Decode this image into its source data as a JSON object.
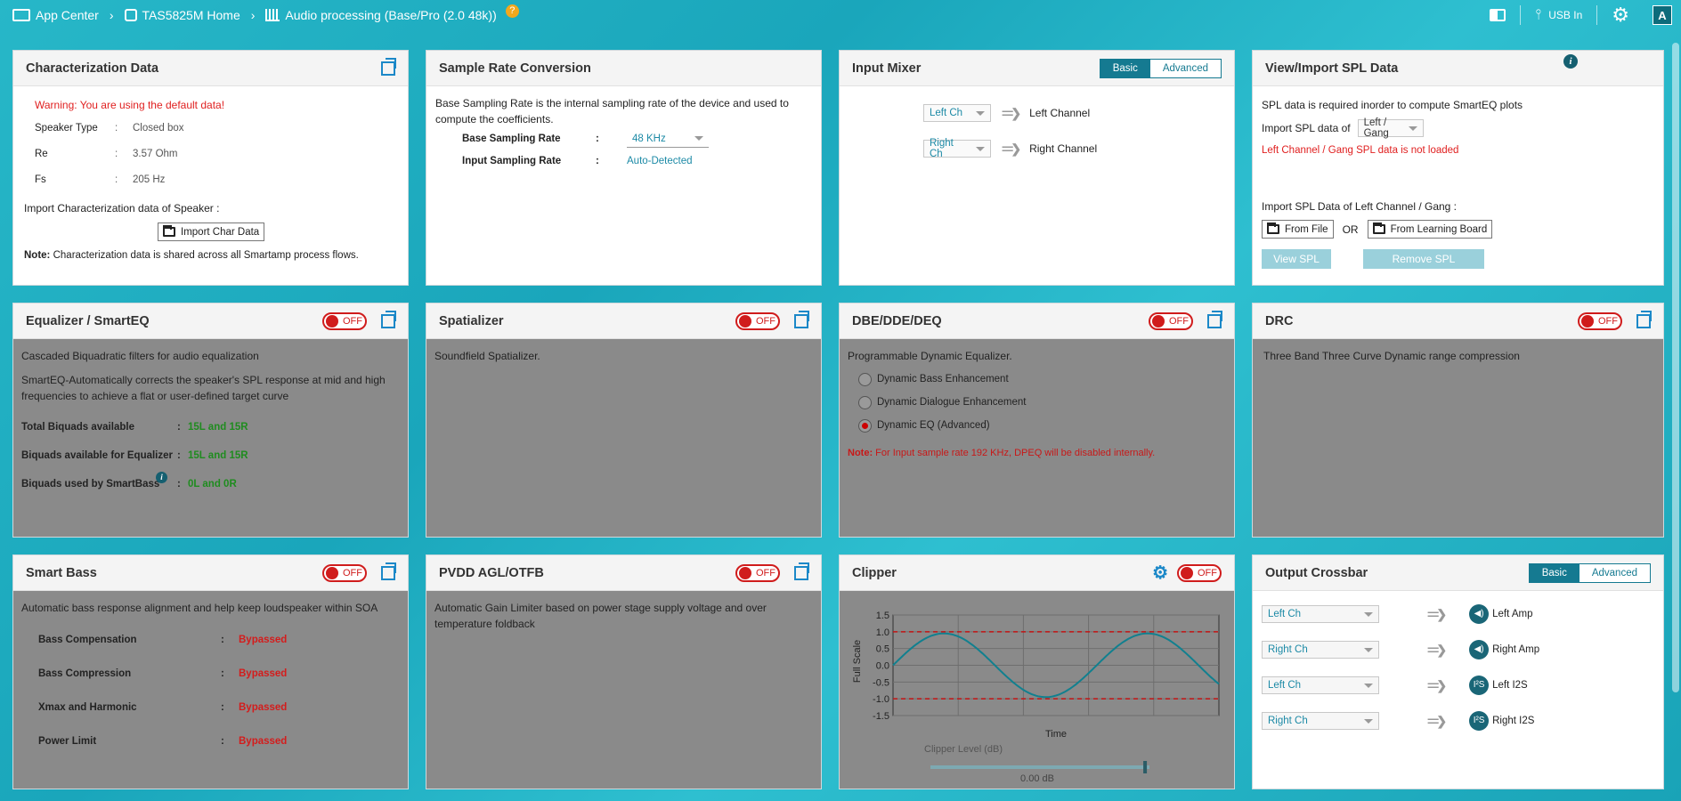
{
  "breadcrumb": {
    "app_center": "App Center",
    "device": "TAS5825M Home",
    "flow": "Audio processing (Base/Pro (2.0 48k))",
    "help": "?"
  },
  "topright": {
    "usb_label": "USB In",
    "avatar": "A"
  },
  "characterization": {
    "title": "Characterization Data",
    "warning": "Warning: You are using the default data!",
    "rows": [
      {
        "label": "Speaker Type",
        "value": "Closed box"
      },
      {
        "label": "Re",
        "value": "3.57 Ohm"
      },
      {
        "label": "Fs",
        "value": "205 Hz"
      }
    ],
    "import_label": "Import Characterization data of Speaker :",
    "import_button": "Import Char Data",
    "note_bold": "Note:",
    "note_text": "Characterization data is shared across all Smartamp process flows."
  },
  "src": {
    "title": "Sample Rate Conversion",
    "desc": "Base Sampling Rate is the internal sampling rate of the device and used to compute the coefficients.",
    "base_label": "Base Sampling Rate",
    "base_value": "48 KHz",
    "input_label": "Input Sampling Rate",
    "input_value": "Auto-Detected"
  },
  "input_mixer": {
    "title": "Input Mixer",
    "seg_basic": "Basic",
    "seg_advanced": "Advanced",
    "rows": [
      {
        "source": "Left Ch",
        "target": "Left Channel"
      },
      {
        "source": "Right Ch",
        "target": "Right Channel"
      }
    ]
  },
  "spl": {
    "title": "View/Import SPL Data",
    "desc": "SPL data is required inorder to compute SmartEQ plots",
    "import_of": "Import SPL data of",
    "import_of_value": "Left / Gang",
    "warning": "Left Channel / Gang SPL data is not loaded",
    "import_label": "Import SPL Data of Left Channel / Gang :",
    "from_file": "From File",
    "or": "OR",
    "from_board": "From Learning Board",
    "view_spl": "View SPL",
    "remove_spl": "Remove SPL"
  },
  "equalizer": {
    "title": "Equalizer / SmartEQ",
    "toggle": "OFF",
    "desc1": "Cascaded Biquadratic filters for audio equalization",
    "desc2": "SmartEQ-Automatically corrects the speaker's SPL response at mid and high frequencies to achieve a flat or user-defined target curve",
    "rows": [
      {
        "label": "Total Biquads available",
        "value": "15L and 15R"
      },
      {
        "label": "Biquads available for Equalizer",
        "value": "15L and 15R"
      },
      {
        "label": "Biquads used by SmartBass",
        "value": "0L and 0R"
      }
    ]
  },
  "spatializer": {
    "title": "Spatializer",
    "toggle": "OFF",
    "desc": "Soundfield Spatializer."
  },
  "dbe": {
    "title": "DBE/DDE/DEQ",
    "toggle": "OFF",
    "desc": "Programmable Dynamic Equalizer.",
    "options": [
      "Dynamic Bass Enhancement",
      "Dynamic Dialogue Enhancement",
      "Dynamic EQ (Advanced)"
    ],
    "selected": 2,
    "note_bold": "Note:",
    "note_text": "For Input sample rate 192 KHz, DPEQ will be disabled internally."
  },
  "drc": {
    "title": "DRC",
    "toggle": "OFF",
    "desc": "Three Band Three Curve Dynamic range compression"
  },
  "smartbass": {
    "title": "Smart Bass",
    "toggle": "OFF",
    "desc": "Automatic bass response alignment and help keep loudspeaker within SOA",
    "rows": [
      {
        "label": "Bass Compensation",
        "value": "Bypassed"
      },
      {
        "label": "Bass Compression",
        "value": "Bypassed"
      },
      {
        "label": "Xmax and Harmonic",
        "value": "Bypassed"
      },
      {
        "label": "Power Limit",
        "value": "Bypassed"
      }
    ]
  },
  "pvdd": {
    "title": "PVDD AGL/OTFB",
    "toggle": "OFF",
    "desc": "Automatic Gain Limiter based on power stage supply voltage and over temperature foldback"
  },
  "clipper": {
    "title": "Clipper",
    "toggle": "OFF",
    "slider_label": "Clipper Level (dB)",
    "slider_value": "0.00 dB",
    "slider_fraction": 0.98
  },
  "chart_data": {
    "type": "line",
    "xlabel": "Time",
    "ylabel": "Full Scale",
    "ylim": [
      -1.5,
      1.5
    ],
    "yticks": [
      "1.5",
      "1.0",
      "0.5",
      "0.0",
      "-0.5",
      "-1.0",
      "-1.5"
    ],
    "grid": true,
    "series": [
      {
        "values": [
          0.0,
          0.59,
          0.95,
          0.95,
          0.59,
          0.0,
          -0.59,
          -0.95,
          -0.95,
          -0.59,
          0.0,
          0.59,
          0.95,
          0.95,
          0.59,
          0.0,
          -0.59
        ]
      },
      {
        "values": [
          1.0,
          1.0
        ]
      },
      {
        "values": [
          -1.0,
          -1.0
        ]
      }
    ]
  },
  "crossbar": {
    "title": "Output Crossbar",
    "seg_basic": "Basic",
    "seg_advanced": "Advanced",
    "rows": [
      {
        "source": "Left Ch",
        "target": "Left Amp",
        "icon": "speaker-icon"
      },
      {
        "source": "Right Ch",
        "target": "Right Amp",
        "icon": "speaker-icon"
      },
      {
        "source": "Left Ch",
        "target": "Left I2S",
        "icon": "i2s-icon"
      },
      {
        "source": "Right Ch",
        "target": "Right I2S",
        "icon": "i2s-icon"
      }
    ]
  }
}
